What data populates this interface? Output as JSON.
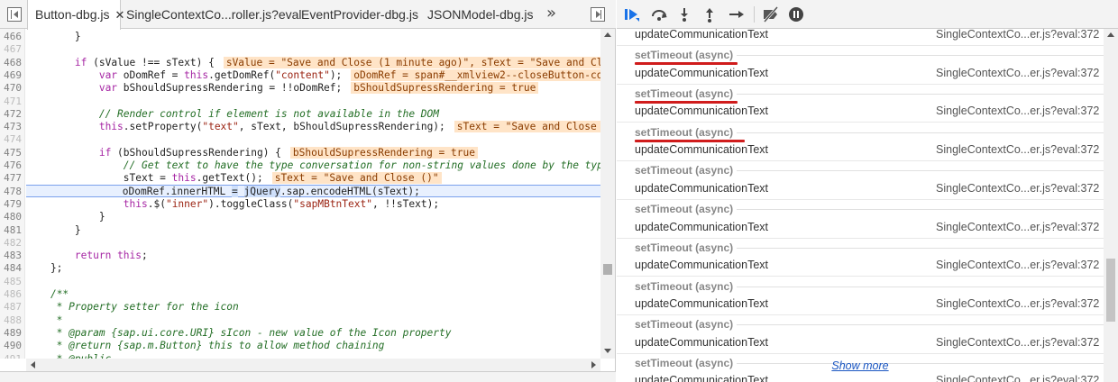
{
  "editor": {
    "tabs": [
      {
        "label": "Button-dbg.js",
        "active": true
      },
      {
        "label": "SingleContextCo...roller.js?eval",
        "active": false
      },
      {
        "label": "EventProvider-dbg.js",
        "active": false
      },
      {
        "label": "JSONModel-dbg.js",
        "active": false
      }
    ],
    "more_tabs_symbol": "»",
    "lines": [
      {
        "n": "466",
        "html": "        }"
      },
      {
        "n": "467",
        "html": ""
      },
      {
        "n": "468",
        "html": "        <span class=\"kw\">if</span> (sValue !== sText) {<span class=\"ev\">sValue = \"Save and Close (1 minute ago)\", sText = \"Save and Close ()\"</span>"
      },
      {
        "n": "469",
        "html": "            <span class=\"kw\">var</span> oDomRef = <span class=\"kw\">this</span>.getDomRef(<span class=\"str\">\"content\"</span>);<span class=\"ev\">oDomRef = span#__xmlview2--closeButton-content</span>"
      },
      {
        "n": "470",
        "html": "            <span class=\"kw\">var</span> bShouldSupressRendering = !!oDomRef;<span class=\"ev\">bShouldSupressRendering = true</span>"
      },
      {
        "n": "471",
        "html": ""
      },
      {
        "n": "472",
        "html": "            <span class=\"cmt\">// Render control if element is not available in the DOM</span>"
      },
      {
        "n": "473",
        "html": "            <span class=\"kw\">this</span>.setProperty(<span class=\"str\">\"text\"</span>, sText, bShouldSupressRendering);<span class=\"ev\">sText = \"Save and Close ()\"</span>"
      },
      {
        "n": "474",
        "html": ""
      },
      {
        "n": "475",
        "html": "            <span class=\"kw\">if</span> (bShouldSupressRendering) {<span class=\"ev\">bShouldSupressRendering = true</span>"
      },
      {
        "n": "476",
        "html": "                <span class=\"cmt\">// Get text to have the type conversation for non-string values done by the type</span>"
      },
      {
        "n": "477",
        "html": "                sText = <span class=\"kw\">this</span>.getText();<span class=\"ev\">sText = \"Save and Close ()\"</span>"
      },
      {
        "n": "478",
        "html": "                oDomRef.innerHTML <span class=\"sel\">=</span> <span class=\"sel\">jQuery</span>.sap.encodeHTML(sText);",
        "hl": true
      },
      {
        "n": "479",
        "html": "                <span class=\"kw\">this</span>.$(<span class=\"str\">\"inner\"</span>).toggleClass(<span class=\"str\">\"sapMBtnText\"</span>, !!sText);"
      },
      {
        "n": "480",
        "html": "            }"
      },
      {
        "n": "481",
        "html": "        }"
      },
      {
        "n": "482",
        "html": ""
      },
      {
        "n": "483",
        "html": "        <span class=\"kw\">return</span> <span class=\"kw\">this</span>;"
      },
      {
        "n": "484",
        "html": "    };"
      },
      {
        "n": "485",
        "html": ""
      },
      {
        "n": "486",
        "html": "    <span class=\"cmt\">/**</span>"
      },
      {
        "n": "487",
        "html": "<span class=\"cmt\">     * Property setter for the icon</span>"
      },
      {
        "n": "488",
        "html": "<span class=\"cmt\">     *</span>"
      },
      {
        "n": "489",
        "html": "<span class=\"cmt\">     * @param {sap.ui.core.URI} sIcon - new value of the Icon property</span>"
      },
      {
        "n": "490",
        "html": "<span class=\"cmt\">     * @return {sap.m.Button} this to allow method chaining</span>"
      },
      {
        "n": "491",
        "html": "<span class=\"cmt\">     * @public</span>"
      }
    ],
    "dim_lines": [
      "467",
      "471",
      "474",
      "482",
      "485",
      "486",
      "487",
      "488",
      "491"
    ]
  },
  "debugger": {
    "toolbar": [
      "resume",
      "step-over",
      "step-into",
      "step-out",
      "step",
      "deactivate-breakpoints",
      "pause-on-exceptions"
    ],
    "call_stack": [
      {
        "fn": "updateCommunicationText",
        "loc": "SingleContextCo...er.js?eval:372"
      },
      {
        "async": "setTimeout (async)",
        "underlined": true
      },
      {
        "fn": "updateCommunicationText",
        "loc": "SingleContextCo...er.js?eval:372"
      },
      {
        "async": "setTimeout (async)",
        "underlined": true
      },
      {
        "fn": "updateCommunicationText",
        "loc": "SingleContextCo...er.js?eval:372"
      },
      {
        "async": "setTimeout (async)",
        "underlined": true
      },
      {
        "fn": "updateCommunicationText",
        "loc": "SingleContextCo...er.js?eval:372"
      },
      {
        "async": "setTimeout (async)"
      },
      {
        "fn": "updateCommunicationText",
        "loc": "SingleContextCo...er.js?eval:372"
      },
      {
        "async": "setTimeout (async)"
      },
      {
        "fn": "updateCommunicationText",
        "loc": "SingleContextCo...er.js?eval:372"
      },
      {
        "async": "setTimeout (async)"
      },
      {
        "fn": "updateCommunicationText",
        "loc": "SingleContextCo...er.js?eval:372"
      },
      {
        "async": "setTimeout (async)"
      },
      {
        "fn": "updateCommunicationText",
        "loc": "SingleContextCo...er.js?eval:372"
      },
      {
        "async": "setTimeout (async)"
      },
      {
        "fn": "updateCommunicationText",
        "loc": "SingleContextCo...er.js?eval:372"
      },
      {
        "async": "setTimeout (async)"
      },
      {
        "fn": "updateCommunicationText",
        "loc": "SingleContextCo...er.js?eval:372"
      }
    ],
    "show_more": "Show more"
  },
  "colors": {
    "accent": "#1a73e8",
    "annotation_bg": "#ffe4c7",
    "underline_red": "#d01c1c",
    "current_line_bg": "#e8f0fe"
  }
}
